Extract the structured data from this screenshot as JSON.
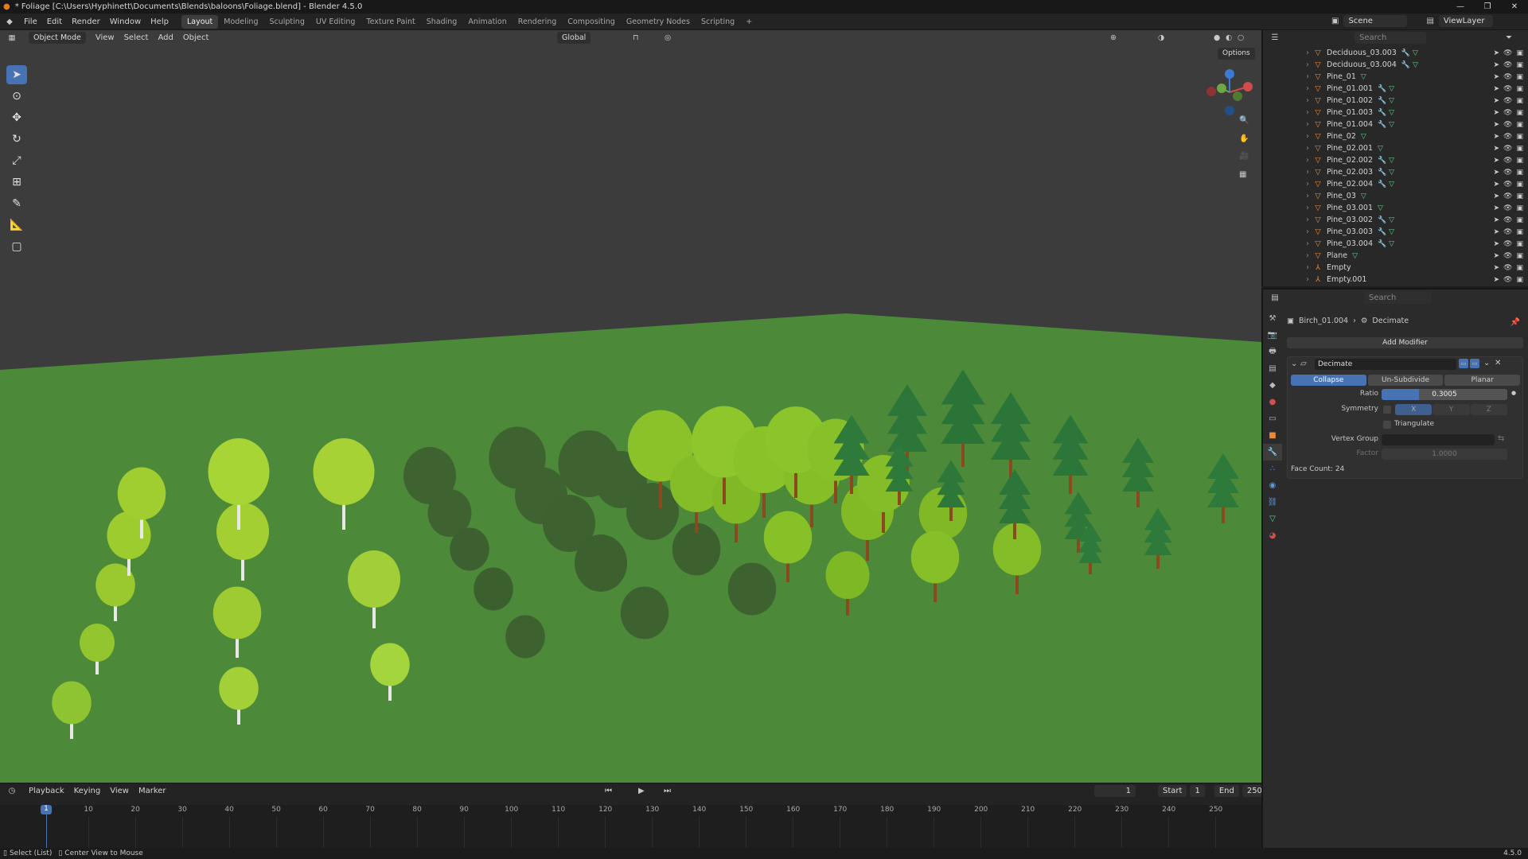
{
  "window": {
    "title": "* Foliage [C:\\Users\\Hyphinett\\Documents\\Blends\\baloons\\Foliage.blend] - Blender 4.5.0",
    "min": "—",
    "max": "❐",
    "close": "✕"
  },
  "menu": [
    "File",
    "Edit",
    "Render",
    "Window",
    "Help"
  ],
  "workspaces": [
    "Layout",
    "Modeling",
    "Sculpting",
    "UV Editing",
    "Texture Paint",
    "Shading",
    "Animation",
    "Rendering",
    "Compositing",
    "Geometry Nodes",
    "Scripting",
    "+"
  ],
  "active_workspace": "Layout",
  "scene": "Scene",
  "view_layer": "ViewLayer",
  "viewport": {
    "mode": "Object Mode",
    "menus": [
      "View",
      "Select",
      "Add",
      "Object"
    ],
    "orientation": "Global",
    "options": "Options"
  },
  "outliner": {
    "search": "Search",
    "items": [
      {
        "name": "Deciduous_03.003",
        "kind": "mesh",
        "mod": true
      },
      {
        "name": "Deciduous_03.004",
        "kind": "mesh",
        "mod": true
      },
      {
        "name": "Pine_01",
        "kind": "mesh",
        "mod": false
      },
      {
        "name": "Pine_01.001",
        "kind": "mesh",
        "mod": true
      },
      {
        "name": "Pine_01.002",
        "kind": "mesh",
        "mod": true
      },
      {
        "name": "Pine_01.003",
        "kind": "mesh",
        "mod": true
      },
      {
        "name": "Pine_01.004",
        "kind": "mesh",
        "mod": true
      },
      {
        "name": "Pine_02",
        "kind": "mesh",
        "mod": false
      },
      {
        "name": "Pine_02.001",
        "kind": "mesh",
        "mod": false
      },
      {
        "name": "Pine_02.002",
        "kind": "mesh",
        "mod": true
      },
      {
        "name": "Pine_02.003",
        "kind": "mesh",
        "mod": true
      },
      {
        "name": "Pine_02.004",
        "kind": "mesh",
        "mod": true
      },
      {
        "name": "Pine_03",
        "kind": "mesh",
        "mod": false
      },
      {
        "name": "Pine_03.001",
        "kind": "mesh",
        "mod": false
      },
      {
        "name": "Pine_03.002",
        "kind": "mesh",
        "mod": true
      },
      {
        "name": "Pine_03.003",
        "kind": "mesh",
        "mod": true
      },
      {
        "name": "Pine_03.004",
        "kind": "mesh",
        "mod": true
      },
      {
        "name": "Plane",
        "kind": "mesh",
        "mod": false
      },
      {
        "name": "Empty",
        "kind": "empty",
        "mod": false
      },
      {
        "name": "Empty.001",
        "kind": "empty",
        "mod": false
      }
    ]
  },
  "properties": {
    "search": "Search",
    "object": "Birch_01.004",
    "modifier_crumb": "Decimate",
    "add_modifier": "Add Modifier",
    "modifier": {
      "name": "Decimate",
      "tabs": [
        "Collapse",
        "Un-Subdivide",
        "Planar"
      ],
      "active_tab": "Collapse",
      "ratio_label": "Ratio",
      "ratio": "0.3005",
      "ratio_fraction": 0.3005,
      "symmetry_label": "Symmetry",
      "axes": [
        "X",
        "Y",
        "Z"
      ],
      "triangulate": "Triangulate",
      "vertex_group_label": "Vertex Group",
      "factor_label": "Factor",
      "factor": "1.0000",
      "face_count": "Face Count: 24"
    }
  },
  "timeline": {
    "menus": [
      "Playback",
      "Keying",
      "View",
      "Marker"
    ],
    "current": "1",
    "start_label": "Start",
    "start": "1",
    "end_label": "End",
    "end": "250",
    "ticks": [
      "10",
      "20",
      "30",
      "40",
      "50",
      "60",
      "70",
      "80",
      "90",
      "100",
      "110",
      "120",
      "130",
      "140",
      "150",
      "160",
      "170",
      "180",
      "190",
      "200",
      "210",
      "220",
      "230",
      "240",
      "250"
    ]
  },
  "status": {
    "left1": "Select (List)",
    "left2": "Center View to Mouse",
    "version": "4.5.0"
  }
}
